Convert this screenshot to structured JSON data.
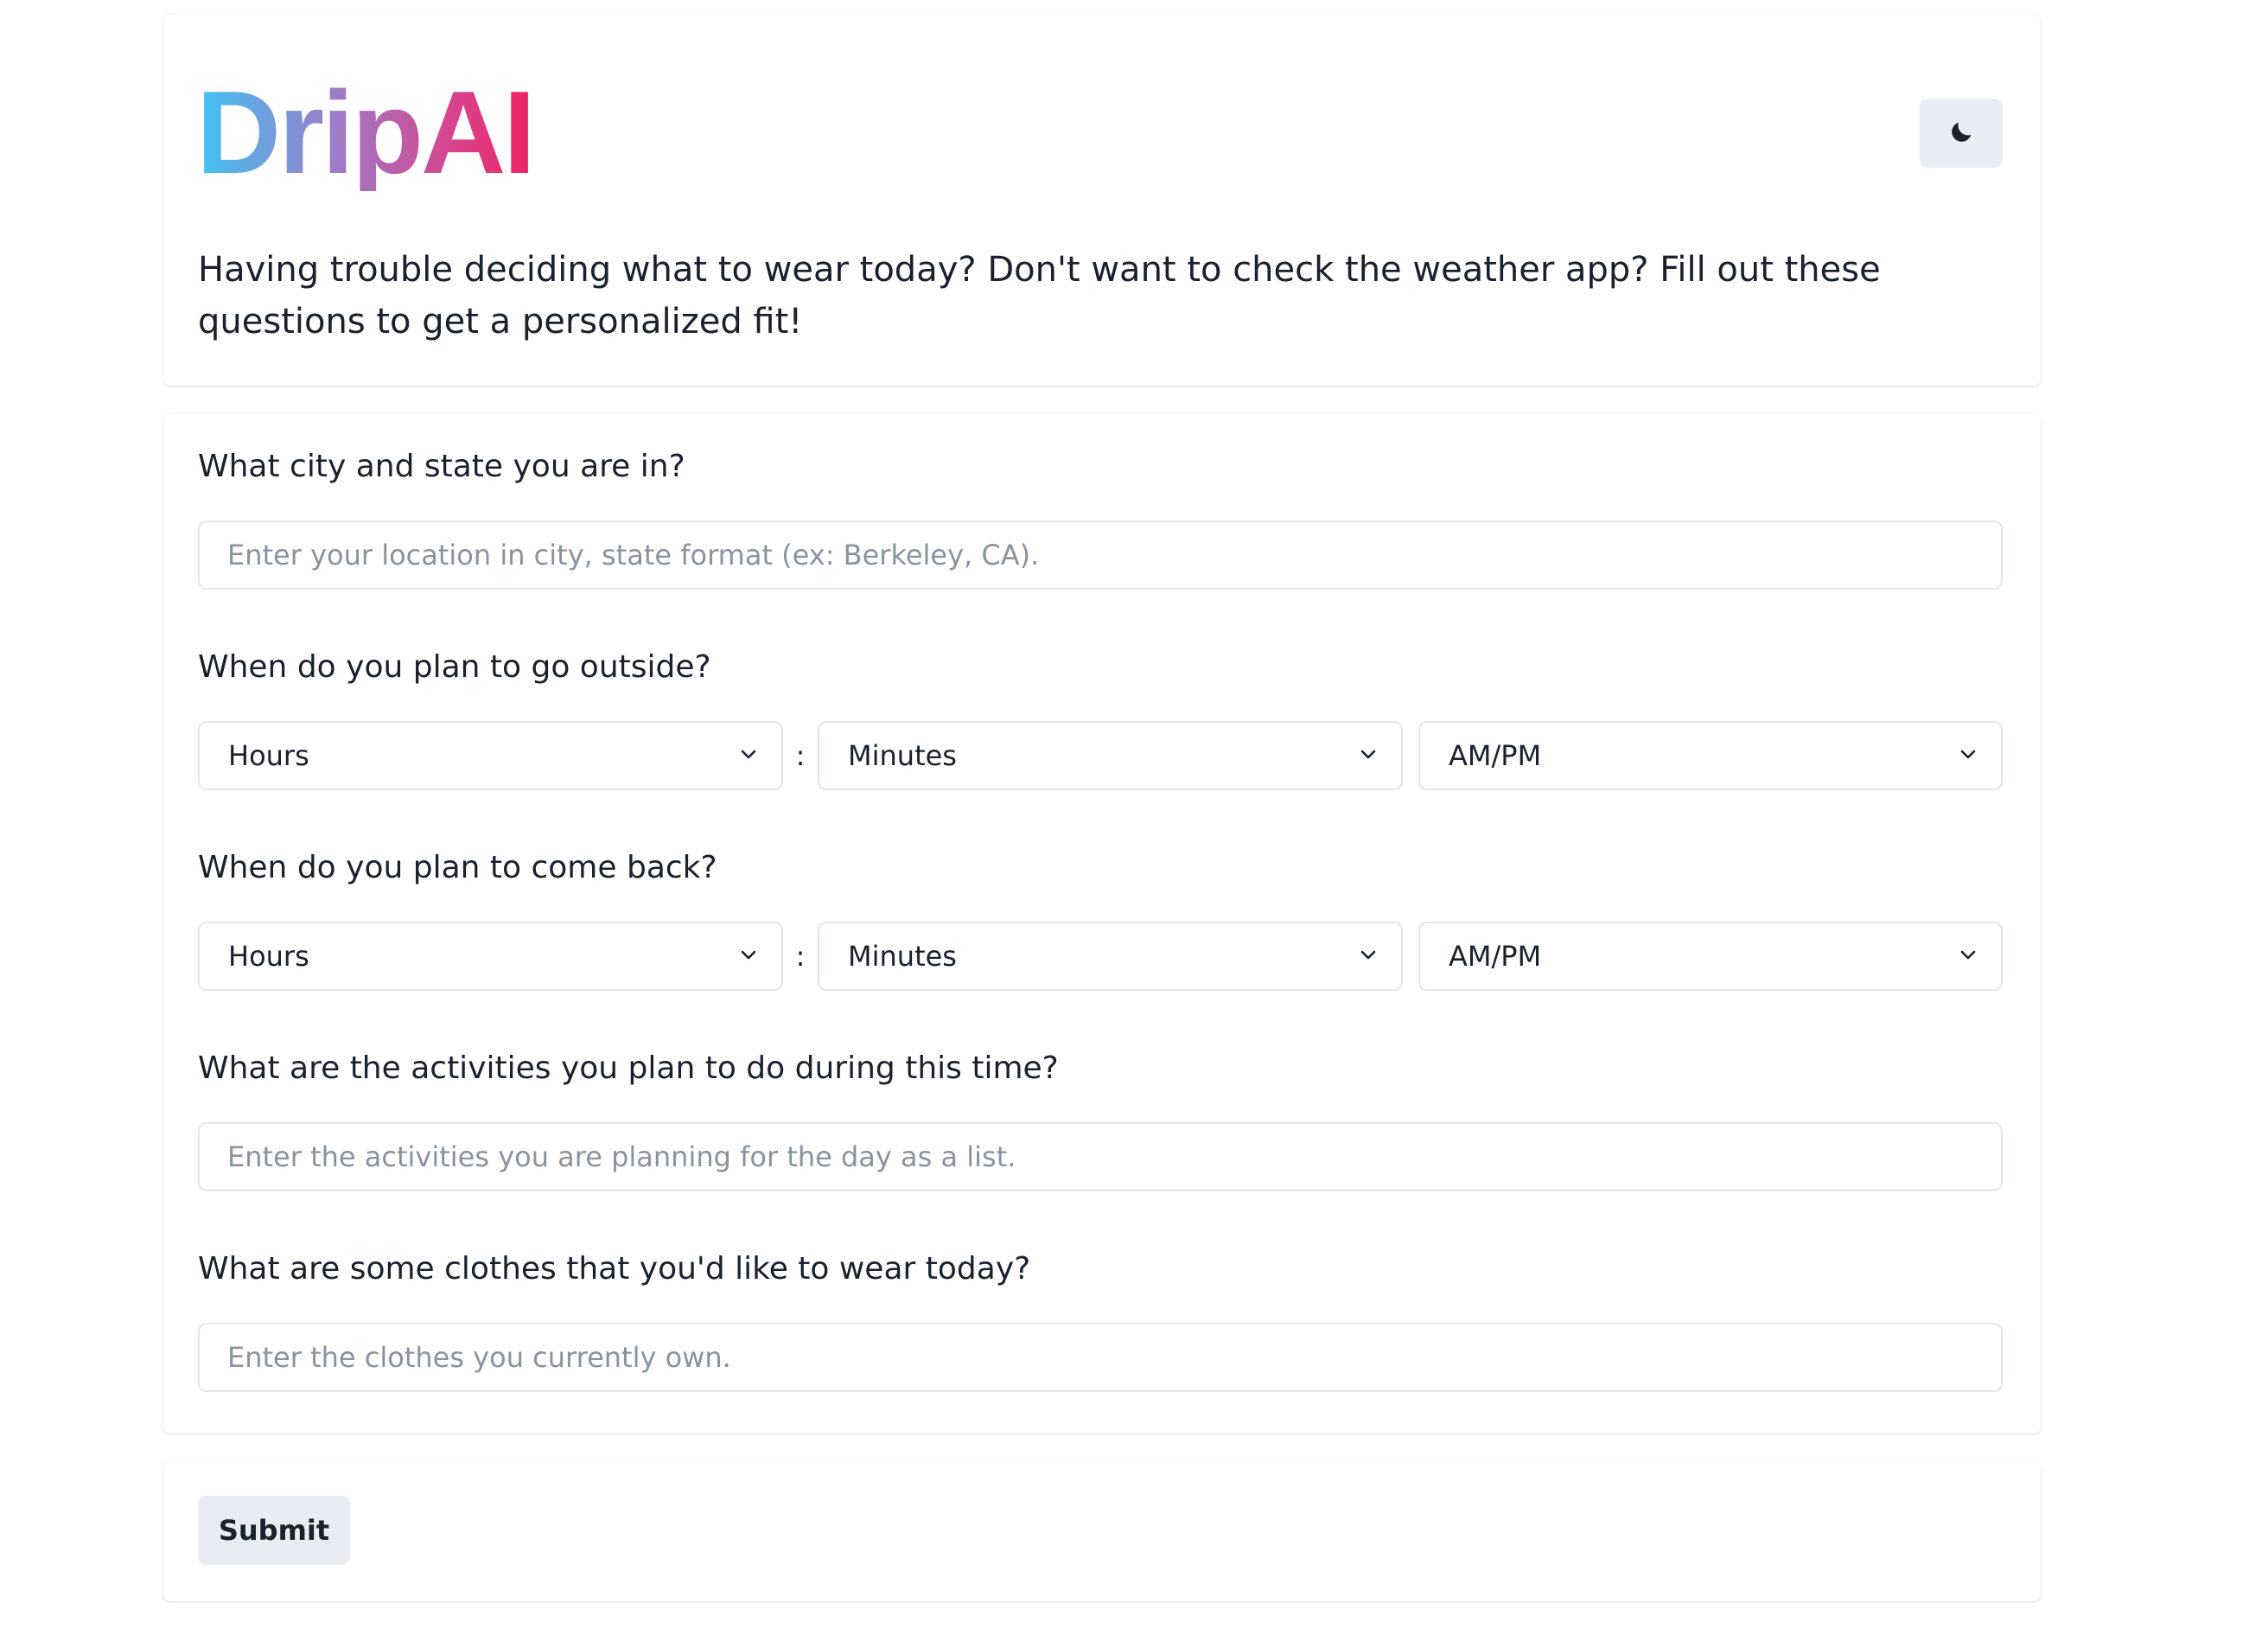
{
  "header": {
    "logo_text": "DripAI",
    "intro_text": "Having trouble deciding what to wear today? Don't want to check the weather app? Fill out these questions to get a personalized fit!",
    "theme_toggle_icon": "moon-icon"
  },
  "form": {
    "location": {
      "label": "What city and state you are in?",
      "placeholder": "Enter your location in city, state format (ex: Berkeley, CA).",
      "value": ""
    },
    "leave_time": {
      "label": "When do you plan to go outside?",
      "hours": "Hours",
      "separator": ":",
      "minutes": "Minutes",
      "ampm": "AM/PM"
    },
    "return_time": {
      "label": "When do you plan to come back?",
      "hours": "Hours",
      "separator": ":",
      "minutes": "Minutes",
      "ampm": "AM/PM"
    },
    "activities": {
      "label": "What are the activities you plan to do during this time?",
      "placeholder": "Enter the activities you are planning for the day as a list.",
      "value": ""
    },
    "clothes": {
      "label": "What are some clothes that you'd like to wear today?",
      "placeholder": "Enter the clothes you currently own.",
      "value": ""
    }
  },
  "submit": {
    "label": "Submit"
  },
  "colors": {
    "logo_gradient": [
      "#3fc3f4",
      "#9a7ec9",
      "#d6468f",
      "#ee2263"
    ],
    "button_bg": "#e9edf3",
    "input_border": "#e2e6ec",
    "placeholder": "#8a929e"
  }
}
